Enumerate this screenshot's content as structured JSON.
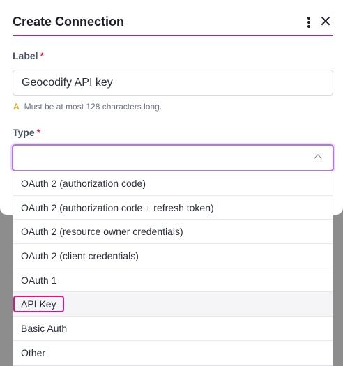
{
  "modal": {
    "title": "Create Connection"
  },
  "label_field": {
    "label": "Label",
    "required_mark": "*",
    "value": "Geocodify API key",
    "hint_icon": "A",
    "hint": "Must be at most 128 characters long."
  },
  "type_field": {
    "label": "Type",
    "required_mark": "*",
    "selected_value": "",
    "options": [
      "OAuth 2 (authorization code)",
      "OAuth 2 (authorization code + refresh token)",
      "OAuth 2 (resource owner credentials)",
      "OAuth 2 (client credentials)",
      "OAuth 1",
      "API Key",
      "Basic Auth",
      "Other"
    ],
    "highlighted_option": "API Key"
  },
  "icons": {
    "menu": "more-vertical-icon",
    "close": "close-icon",
    "dropdown": "chevron-up-icon",
    "hint": "warning-icon"
  },
  "colors": {
    "accent": "#8b2bd6",
    "focus_ring": "#b174ea",
    "highlight_border": "#e0137f",
    "required": "#d6334b",
    "warning": "#e3a820"
  }
}
